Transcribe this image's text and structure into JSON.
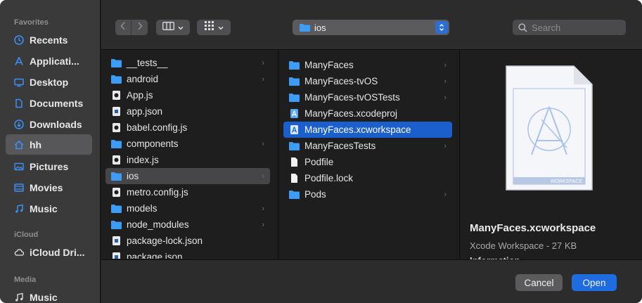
{
  "sidebar": {
    "sections": [
      {
        "label": "Favorites"
      },
      {
        "label": "iCloud"
      },
      {
        "label": "Media"
      }
    ],
    "favorites": [
      {
        "label": "Recents",
        "icon": "clock-icon",
        "color": "#3c8ff5"
      },
      {
        "label": "Applicati...",
        "icon": "applications-icon",
        "color": "#3c8ff5"
      },
      {
        "label": "Desktop",
        "icon": "desktop-icon",
        "color": "#3c8ff5"
      },
      {
        "label": "Documents",
        "icon": "document-icon",
        "color": "#3c8ff5"
      },
      {
        "label": "Downloads",
        "icon": "download-icon",
        "color": "#3c8ff5"
      },
      {
        "label": "hh",
        "icon": "home-icon",
        "color": "#3c8ff5",
        "active": true
      },
      {
        "label": "Pictures",
        "icon": "pictures-icon",
        "color": "#3c8ff5"
      },
      {
        "label": "Movies",
        "icon": "movies-icon",
        "color": "#3c8ff5"
      },
      {
        "label": "Music",
        "icon": "music-icon",
        "color": "#3c8ff5"
      }
    ],
    "icloud": [
      {
        "label": "iCloud Dri...",
        "icon": "cloud-icon"
      }
    ],
    "media": [
      {
        "label": "Music",
        "icon": "music-icon"
      }
    ]
  },
  "toolbar": {
    "path_label": "ios",
    "search_placeholder": "Search"
  },
  "column1": [
    {
      "label": "__tests__",
      "type": "folder",
      "has_children": true
    },
    {
      "label": "android",
      "type": "folder",
      "has_children": true
    },
    {
      "label": "App.js",
      "type": "js"
    },
    {
      "label": "app.json",
      "type": "json"
    },
    {
      "label": "babel.config.js",
      "type": "js"
    },
    {
      "label": "components",
      "type": "folder",
      "has_children": true
    },
    {
      "label": "index.js",
      "type": "js"
    },
    {
      "label": "ios",
      "type": "folder",
      "has_children": true,
      "selected": true
    },
    {
      "label": "metro.config.js",
      "type": "js"
    },
    {
      "label": "models",
      "type": "folder",
      "has_children": true
    },
    {
      "label": "node_modules",
      "type": "folder",
      "has_children": true
    },
    {
      "label": "package-lock.json",
      "type": "json"
    },
    {
      "label": "package.json",
      "type": "json"
    }
  ],
  "column2": [
    {
      "label": "ManyFaces",
      "type": "folder",
      "has_children": true
    },
    {
      "label": "ManyFaces-tvOS",
      "type": "folder",
      "has_children": true
    },
    {
      "label": "ManyFaces-tvOSTests",
      "type": "folder",
      "has_children": true
    },
    {
      "label": "ManyFaces.xcodeproj",
      "type": "xcode"
    },
    {
      "label": "ManyFaces.xcworkspace",
      "type": "xcode",
      "selected": true
    },
    {
      "label": "ManyFacesTests",
      "type": "folder",
      "has_children": true
    },
    {
      "label": "Podfile",
      "type": "file"
    },
    {
      "label": "Podfile.lock",
      "type": "file"
    },
    {
      "label": "Pods",
      "type": "folder",
      "has_children": true
    }
  ],
  "preview": {
    "name": "ManyFaces.xcworkspace",
    "subtitle": "Xcode Workspace - 27 KB",
    "info": "Information",
    "badge": "WORKSPACE"
  },
  "footer": {
    "cancel_label": "Cancel",
    "open_label": "Open"
  },
  "colors": {
    "accent": "#1f6be0",
    "folder": "#3d9cf5",
    "selection_blue": "#1b5fcc"
  }
}
